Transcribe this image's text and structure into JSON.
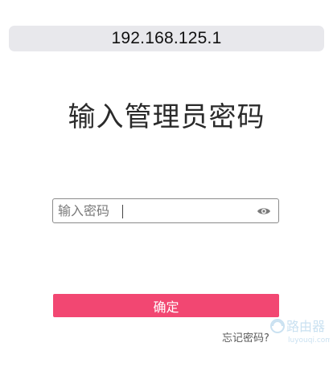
{
  "address_bar": {
    "url": "192.168.125.1"
  },
  "login": {
    "title": "输入管理员密码",
    "password_placeholder": "输入密码",
    "confirm_label": "确定",
    "forgot_label": "忘记密码?"
  },
  "icons": {
    "show_password": "eye-icon"
  },
  "colors": {
    "accent": "#f24772",
    "address_bar_bg": "#e8e8ec",
    "field_border": "#8a8a8a"
  },
  "watermark": {
    "text_cn": "路由器",
    "text_en": "luyouqi.com"
  }
}
